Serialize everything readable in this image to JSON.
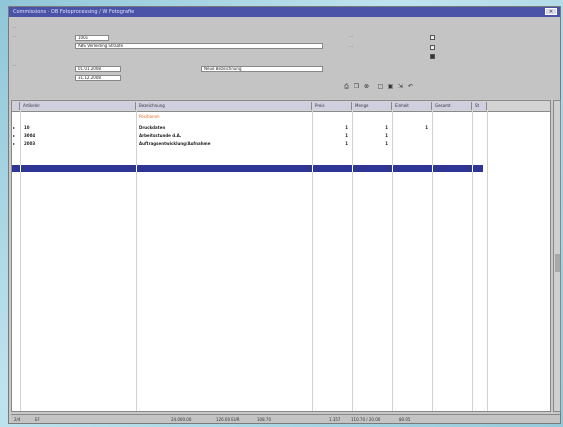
{
  "window": {
    "title": "Commissions · OB Fotoprocessing / W Fotografie"
  },
  "form": {
    "code_value": "1001",
    "name_value": "ABS Verleiding Straate",
    "date_from": "01.01.2008",
    "date_to": "31.12.2008",
    "description": "Neue Bezeichnung"
  },
  "grid": {
    "columns": [
      "Artikelnr",
      "Bezeichnung",
      "Preis",
      "Menge",
      "Einheit",
      "Gesamt",
      "St"
    ],
    "rows": [
      {
        "nr": "",
        "name": "Positionen",
        "preis": "",
        "menge": "",
        "einheit": "",
        "note": true
      },
      {
        "nr": "10",
        "name": "Druckdaten",
        "preis": "1",
        "menge": "1",
        "einheit": "1"
      },
      {
        "nr": "3004",
        "name": "Arbeitsstunde d.A.",
        "preis": "1",
        "menge": "1",
        "einheit": ""
      },
      {
        "nr": "2003",
        "name": "Auftragsentwicklung/Aufnahme",
        "preis": "1",
        "menge": "1",
        "einheit": ""
      }
    ]
  },
  "status": {
    "count": "2/4",
    "mode": "EF",
    "total_a": "24.000.00",
    "total_b": "126.00 EUR",
    "total_c": "108.70",
    "total_d": "1.357",
    "total_e": "110.70 / 20.00",
    "total_f": "80.05"
  },
  "icons": [
    "print-icon",
    "copy-icon",
    "delete-icon",
    "new-icon",
    "save-icon",
    "export-icon",
    "undo-icon"
  ]
}
